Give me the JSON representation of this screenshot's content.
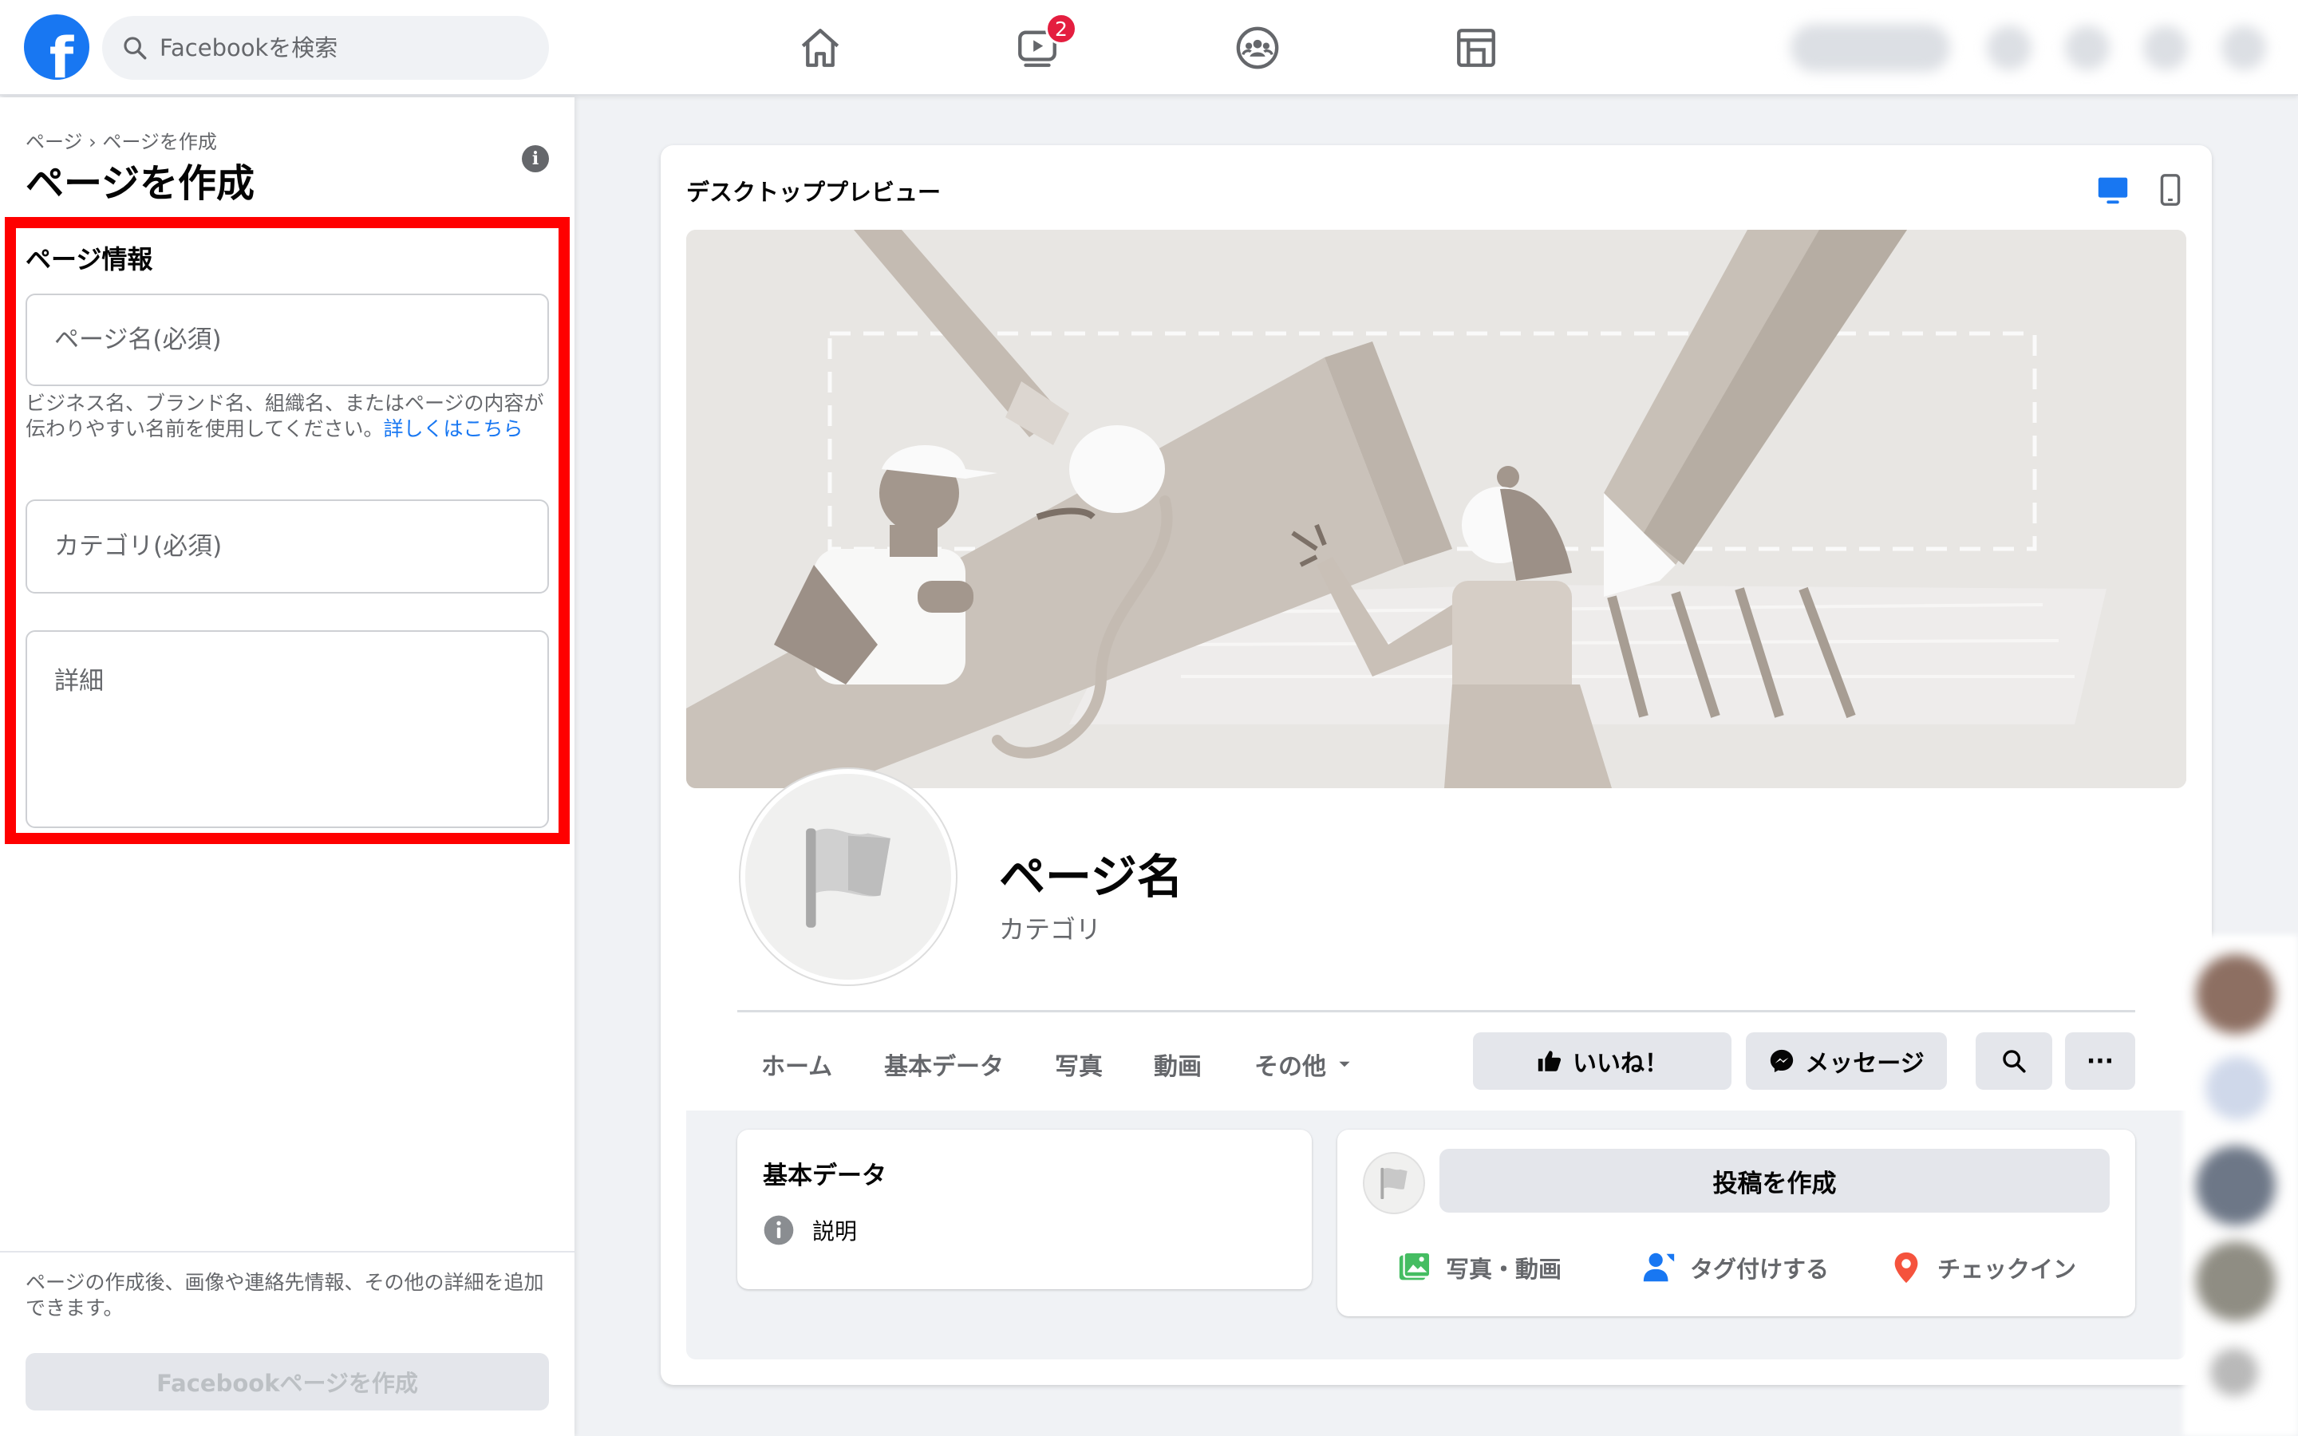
{
  "topbar": {
    "logo_letter": "f",
    "search_placeholder": "Facebookを検索",
    "video_badge": "2"
  },
  "left": {
    "breadcrumb": "ページ › ページを作成",
    "title": "ページを作成",
    "info_glyph": "i",
    "section_label": "ページ情報",
    "page_name_placeholder": "ページ名(必須)",
    "hint_text": "ビジネス名、ブランド名、組織名、またはページの内容が伝わりやすい名前を使用してください。",
    "hint_link": "詳しくはこちら",
    "category_placeholder": "カテゴリ(必須)",
    "details_placeholder": "詳細",
    "bottom_note": "ページの作成後、画像や連絡先情報、その他の詳細を追加できます。",
    "create_button": "Facebookページを作成"
  },
  "preview": {
    "title": "デスクトッププレビュー",
    "page_name": "ページ名",
    "category": "カテゴリ",
    "tabs": [
      "ホーム",
      "基本データ",
      "写真",
      "動画",
      "その他"
    ],
    "like_button": "いいね！",
    "message_button": "メッセージ",
    "more_glyph": "···",
    "about_title": "基本データ",
    "about_item": "説明",
    "post_button": "投稿を作成",
    "actions": [
      "写真・動画",
      "タグ付けする",
      "チェックイン"
    ]
  },
  "colors": {
    "brand": "#1877f2",
    "highlight": "#ff0000",
    "badge": "#e41e3f"
  }
}
